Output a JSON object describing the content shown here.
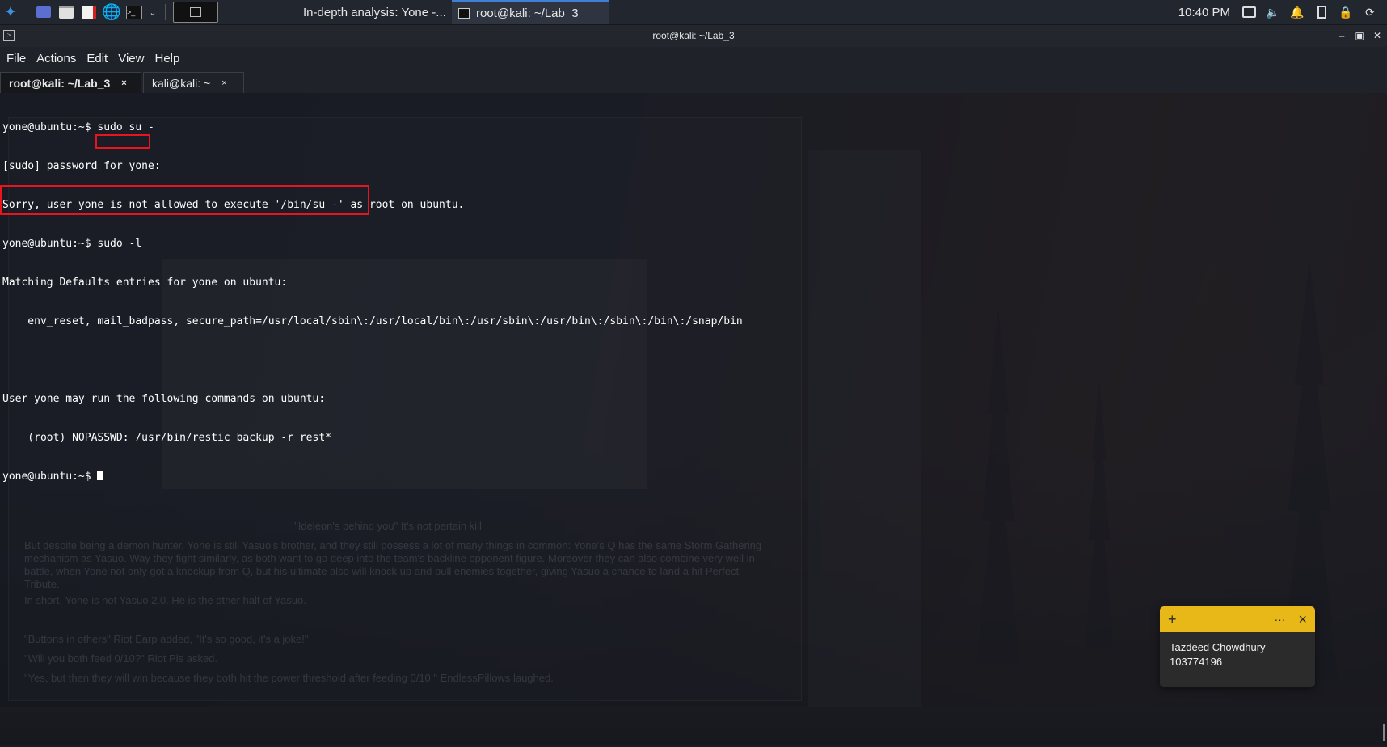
{
  "panel": {
    "tasks": [
      {
        "label": "In-depth analysis: Yone -...",
        "icon": "firefox-icon"
      },
      {
        "label": "root@kali: ~/Lab_3",
        "icon": "terminal-icon"
      }
    ],
    "clock": "10:40 PM"
  },
  "window": {
    "title": "root@kali: ~/Lab_3",
    "menu": [
      "File",
      "Actions",
      "Edit",
      "View",
      "Help"
    ],
    "tabs": [
      {
        "label": "root@kali: ~/Lab_3",
        "active": true
      },
      {
        "label": "kali@kali: ~",
        "active": false
      }
    ],
    "tab_close": "×"
  },
  "terminal": {
    "lines": [
      "yone@ubuntu:~$ sudo su -",
      "[sudo] password for yone:",
      "Sorry, user yone is not allowed to execute '/bin/su -' as root on ubuntu.",
      "yone@ubuntu:~$ sudo -l",
      "Matching Defaults entries for yone on ubuntu:",
      "    env_reset, mail_badpass, secure_path=/usr/local/sbin\\:/usr/local/bin\\:/usr/sbin\\:/usr/bin\\:/sbin\\:/bin\\:/snap/bin",
      "",
      "User yone may run the following commands on ubuntu:",
      "    (root) NOPASSWD: /usr/bin/restic backup -r rest*",
      "yone@ubuntu:~$ "
    ],
    "highlight_color": "#e8141e"
  },
  "background_page": {
    "caption": "\"Ideleon's behind you\" It's not pertain kill",
    "paragraphs": [
      "But despite being a demon hunter, Yone is still Yasuo's brother, and they still possess a lot of many things in common: Yone's Q has the same Storm Gathering mechanism as Yasuo. Way they fight similarly, as both want to go deep into the team's backline opponent figure. Moreover they can also combine very well in battle, when Yone not only got a knockup from Q, but his ultimate also will knock up and pull enemies together, giving Yasuo a chance to land a hit Perfect Tribute.",
      "In short, Yone is not Yasuo 2.0. He is the other half of Yasuo.",
      "\"Buttons in others\" Riot Earp added, \"It's so good, it's a joke!\"",
      "\"Will you both feed 0/10?\" Riot Pls asked.",
      "\"Yes, but then they will win because they both hit the power threshold after feeding 0/10,\" EndlessPillows laughed."
    ]
  },
  "sticky_note": {
    "accent": "#e8b818",
    "add": "+",
    "more": "···",
    "close": "×",
    "lines": [
      "Tazdeed Chowdhury",
      "103774196"
    ]
  }
}
